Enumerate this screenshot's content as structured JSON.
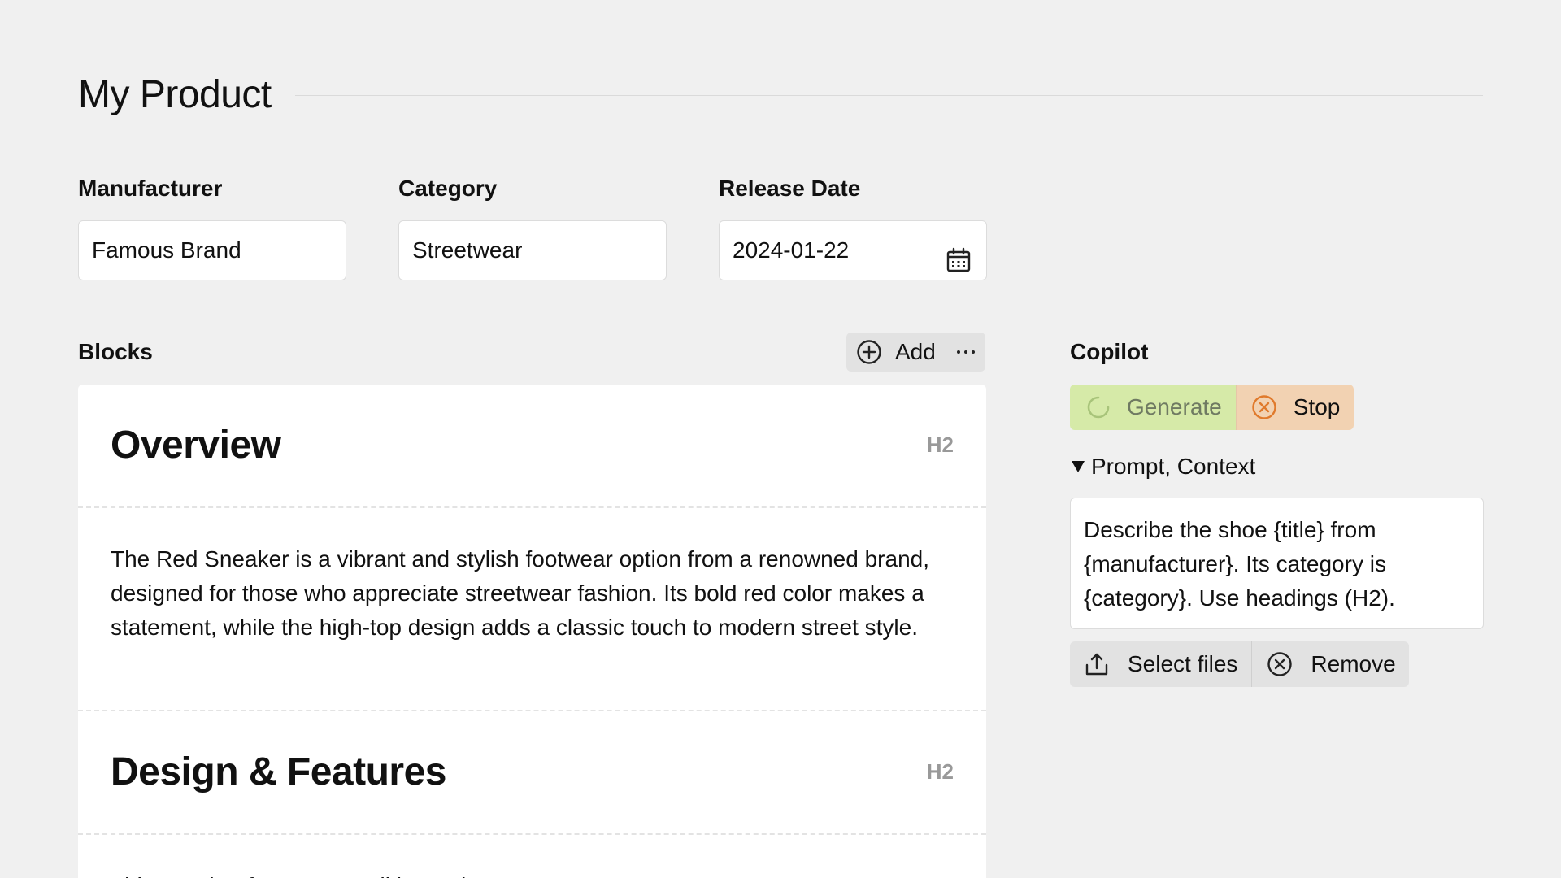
{
  "page": {
    "title": "My Product"
  },
  "fields": {
    "manufacturer": {
      "label": "Manufacturer",
      "value": "Famous Brand"
    },
    "category": {
      "label": "Category",
      "value": "Streetwear"
    },
    "release_date": {
      "label": "Release Date",
      "value": "2024-01-22"
    }
  },
  "blocks": {
    "label": "Blocks",
    "add_label": "Add",
    "items": [
      {
        "heading": "Overview",
        "tag": "H2"
      },
      {
        "paragraph": "The Red Sneaker is a vibrant and stylish footwear option from a renowned brand, designed for those who appreciate streetwear fashion. Its bold red color makes a statement, while the high-top design adds a classic touch to modern street style."
      },
      {
        "heading": "Design & Features",
        "tag": "H2"
      },
      {
        "paragraph": "This sneaker features a striking red..."
      }
    ]
  },
  "copilot": {
    "label": "Copilot",
    "generate_label": "Generate",
    "stop_label": "Stop",
    "prompt_section_label": "Prompt, Context",
    "prompt_text": "Describe the shoe {title} from {manufacturer}. Its category is {category}. Use headings (H2).",
    "select_files_label": "Select files",
    "remove_label": "Remove"
  },
  "colors": {
    "background": "#f0f0f0",
    "generate_bg": "#d6eaa8",
    "stop_bg": "#f2d2b2",
    "stop_icon": "#e07a2c",
    "secondary_button_bg": "#e2e2e2",
    "muted_tag": "#999999"
  },
  "icons": {
    "date": "calendar-icon",
    "add": "plus-circle-icon",
    "more": "ellipsis-icon",
    "generate": "spinner-icon",
    "stop": "close-circle-icon",
    "disclosure": "triangle-down-icon",
    "select_files": "upload-icon",
    "remove": "close-circle-icon"
  }
}
